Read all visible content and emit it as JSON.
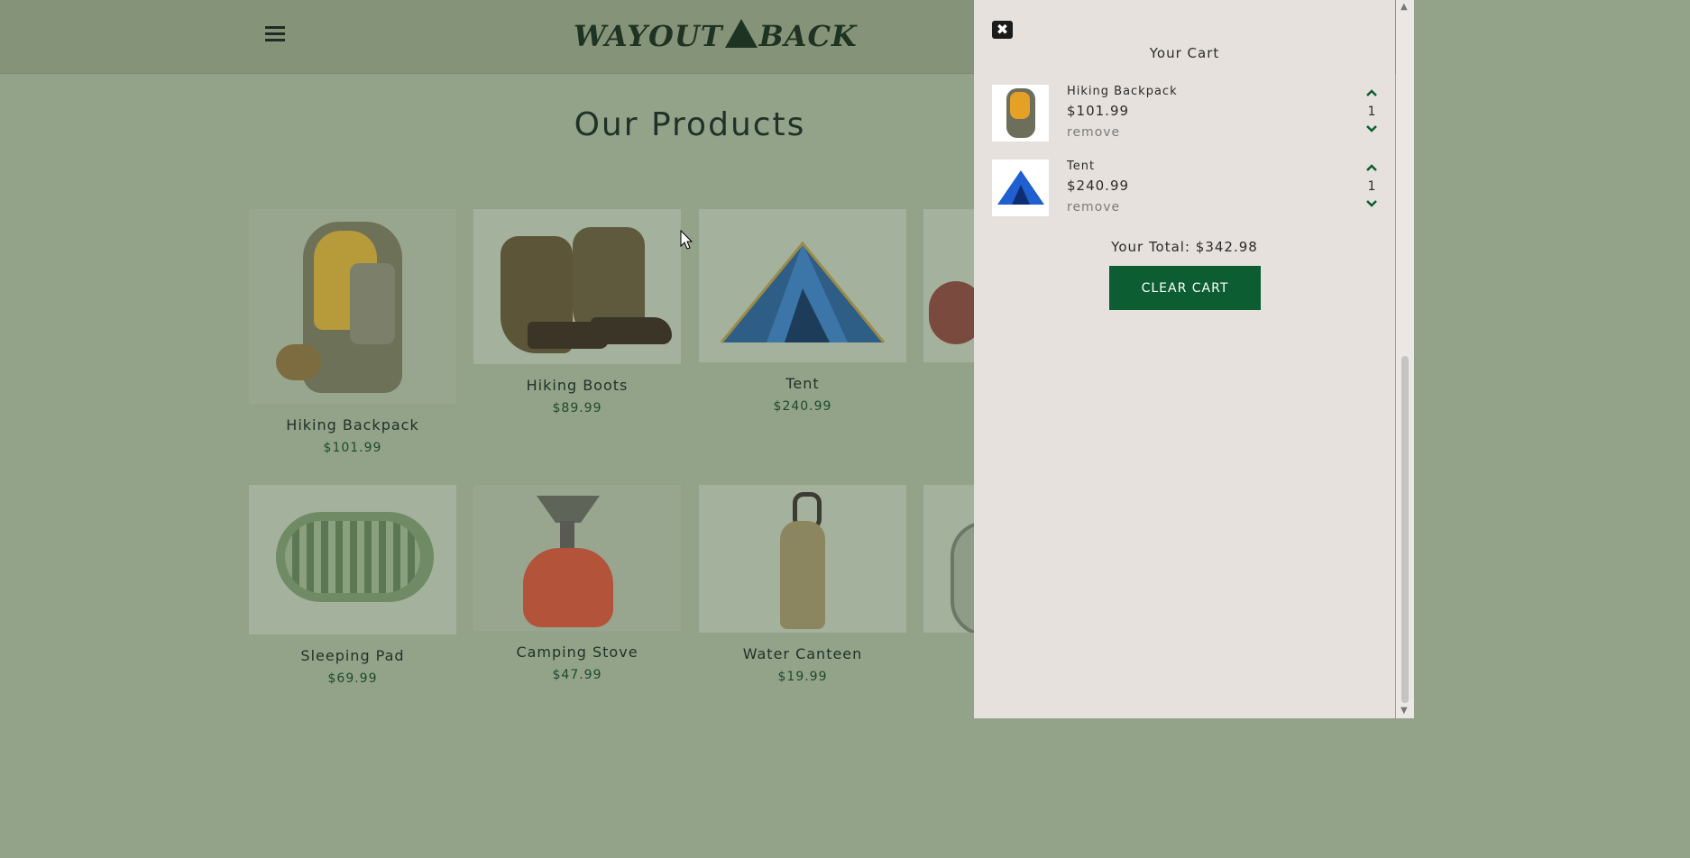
{
  "nav": {
    "logo_left": "WAYOUT",
    "logo_right": "BACK"
  },
  "main": {
    "title": "Our Products",
    "products": [
      {
        "name": "Hiking Backpack",
        "price": "$101.99",
        "icon": "backpack-image"
      },
      {
        "name": "Hiking Boots",
        "price": "$89.99",
        "icon": "boots-image"
      },
      {
        "name": "Tent",
        "price": "$240.99",
        "icon": "tent-image"
      },
      {
        "name": "Sleeping Pad",
        "price": "$69.99",
        "icon": "sleeping-pad-image"
      },
      {
        "name": "Camping Stove",
        "price": "$47.99",
        "icon": "camping-stove-image"
      },
      {
        "name": "Water Canteen",
        "price": "$19.99",
        "icon": "water-canteen-image"
      }
    ]
  },
  "cart": {
    "close_icon": "✖",
    "title": "Your Cart",
    "items": [
      {
        "name": "Hiking Backpack",
        "price": "$101.99",
        "remove_label": "remove",
        "quantity": "1"
      },
      {
        "name": "Tent",
        "price": "$240.99",
        "remove_label": "remove",
        "quantity": "1"
      }
    ],
    "total": "Your Total: $342.98",
    "clear_label": "CLEAR CART"
  },
  "colors": {
    "accent": "#0c5d31",
    "nav_bg": "#859478",
    "cart_bg": "#e6e1dd"
  }
}
